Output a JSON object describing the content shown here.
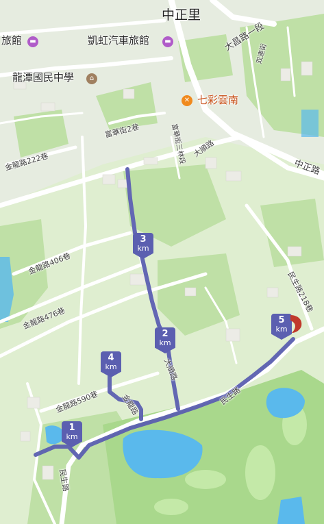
{
  "map": {
    "places": {
      "district": "中正里",
      "hotel_left": "旅館",
      "hotel_kaihong": "凱虹汽車旅館",
      "school": "龍潭國民中學",
      "restaurant": "七彩雲南"
    },
    "roads": {
      "dachang_1": "大昌路一段",
      "zhongzheng": "中正路",
      "shuangjiang": "双連街",
      "fuhua_2": "富華街2巷",
      "fuhua_san": "富華街三林段",
      "dashun": "大順路",
      "jinlong_222": "金龍路222巷",
      "jinlong_406": "金龍路406巷",
      "jinlong_476": "金龍路476巷",
      "jinlong_590": "金龍路590巷",
      "jinlong": "金龍路",
      "minsheng_218": "民生路218巷",
      "minsheng_east": "民生路",
      "minsheng_west": "民生路",
      "dashun_south": "大順路"
    },
    "route": {
      "color": "#5b5fb0",
      "markers": [
        {
          "km": "1",
          "unit": "km"
        },
        {
          "km": "2",
          "unit": "km"
        },
        {
          "km": "3",
          "unit": "km"
        },
        {
          "km": "4",
          "unit": "km"
        },
        {
          "km": "5",
          "unit": "km"
        }
      ]
    },
    "icons": {
      "hotel": "bed-icon",
      "school": "school-icon",
      "restaurant": "fork-knife-icon",
      "end": "end-flag-icon"
    },
    "colors": {
      "land": "#d8ebc4",
      "park": "#bfe0a6",
      "water": "#5ab9ec",
      "road": "#ffffff",
      "hotel_icon": "#b05bc9",
      "restaurant_icon": "#f08a1e",
      "end_marker": "#c0392b"
    }
  }
}
